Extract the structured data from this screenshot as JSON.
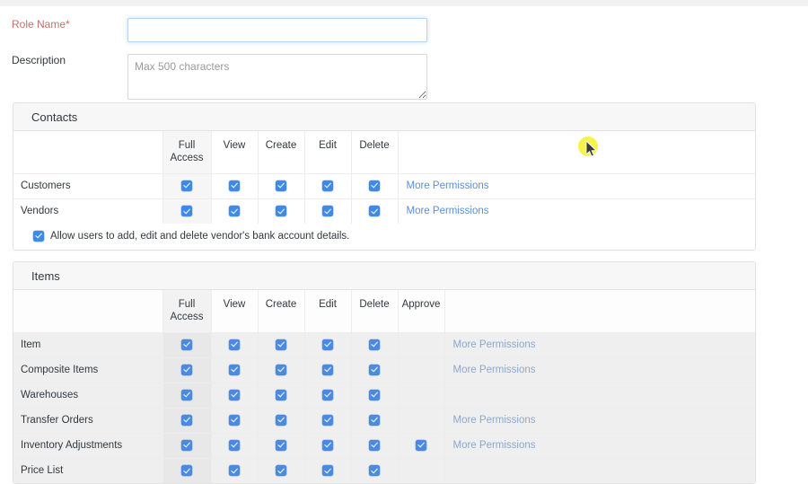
{
  "form": {
    "role_name": {
      "label": "Role Name*",
      "value": "",
      "placeholder": ""
    },
    "description": {
      "label": "Description",
      "value": "",
      "placeholder": "Max 500 characters"
    }
  },
  "more_permissions_label": "More Permissions",
  "contacts": {
    "title": "Contacts",
    "columns": [
      "",
      "Full Access",
      "View",
      "Create",
      "Edit",
      "Delete",
      ""
    ],
    "rows": [
      {
        "name": "Customers",
        "full_access": true,
        "view": true,
        "create": true,
        "edit": true,
        "delete": true,
        "more": true
      },
      {
        "name": "Vendors",
        "full_access": true,
        "view": true,
        "create": true,
        "edit": true,
        "delete": true,
        "more": true
      }
    ],
    "footnote": {
      "checked": true,
      "label": "Allow users to add, edit and delete vendor's bank account details."
    }
  },
  "items": {
    "title": "Items",
    "columns": [
      "",
      "Full Access",
      "View",
      "Create",
      "Edit",
      "Delete",
      "Approve",
      ""
    ],
    "rows": [
      {
        "name": "Item",
        "full_access": true,
        "view": true,
        "create": true,
        "edit": true,
        "delete": true,
        "approve": false,
        "more": true
      },
      {
        "name": "Composite Items",
        "full_access": true,
        "view": true,
        "create": true,
        "edit": true,
        "delete": true,
        "approve": false,
        "more": true
      },
      {
        "name": "Warehouses",
        "full_access": true,
        "view": true,
        "create": true,
        "edit": true,
        "delete": true,
        "approve": false,
        "more": false
      },
      {
        "name": "Transfer Orders",
        "full_access": true,
        "view": true,
        "create": true,
        "edit": true,
        "delete": true,
        "approve": false,
        "more": true
      },
      {
        "name": "Inventory Adjustments",
        "full_access": true,
        "view": true,
        "create": true,
        "edit": true,
        "delete": true,
        "approve": true,
        "more": true
      },
      {
        "name": "Price List",
        "full_access": true,
        "view": true,
        "create": true,
        "edit": true,
        "delete": true,
        "approve": false,
        "more": false
      }
    ]
  },
  "colors": {
    "checkbox_blue": "#3f8ae8",
    "link_blue": "#5b8fd6",
    "required_red": "#c4706a",
    "panel_header_bg": "#f7f7f7",
    "cursor_highlight": "#f5f12a"
  }
}
